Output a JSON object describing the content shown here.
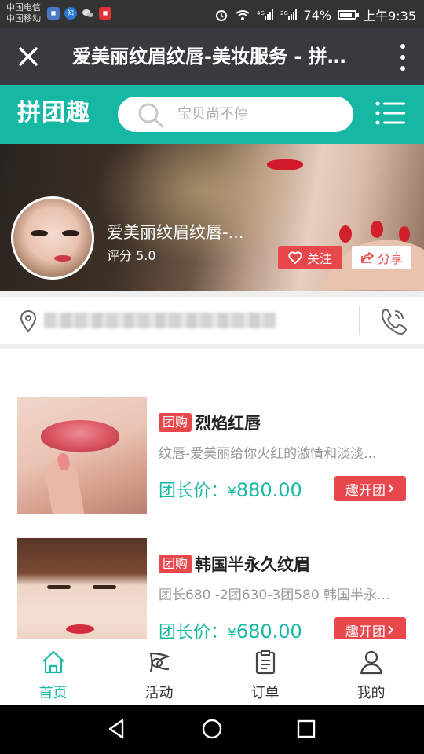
{
  "status_bar": {
    "carrier1": "中国电信",
    "carrier2": "中国移动",
    "battery": "74%",
    "battery_level": 0.74,
    "time": "上午9:35"
  },
  "titlebar": {
    "title": "爱美丽纹眉纹唇-美妆服务 - 拼…"
  },
  "header": {
    "brand": "拼团趣",
    "search_placeholder": "宝贝尚不停"
  },
  "store": {
    "name": "爱美丽纹眉纹唇-...",
    "rating": "评分 5.0",
    "follow_label": "关注",
    "share_label": "分享"
  },
  "products": [
    {
      "tag": "团购",
      "name": "烈焰红唇",
      "desc": "纹唇-爱美丽给你火红的激情和淡淡...",
      "price_label": "团长价：",
      "currency": "¥",
      "price": "880.00",
      "button": "趣开团"
    },
    {
      "tag": "团购",
      "name": "韩国半永久纹眉",
      "desc": "团长680 -2团630-3团580 韩国半永...",
      "price_label": "团长价：",
      "currency": "¥",
      "price": "680.00",
      "button": "趣开团"
    }
  ],
  "bottom_nav": [
    {
      "label": "首页",
      "icon": "home-icon",
      "active": true
    },
    {
      "label": "活动",
      "icon": "activity-icon",
      "active": false
    },
    {
      "label": "订单",
      "icon": "order-icon",
      "active": false
    },
    {
      "label": "我的",
      "icon": "user-icon",
      "active": false
    }
  ],
  "colors": {
    "accent": "#17b8a3",
    "red": "#e8474b",
    "titlebar": "#393a3f"
  }
}
